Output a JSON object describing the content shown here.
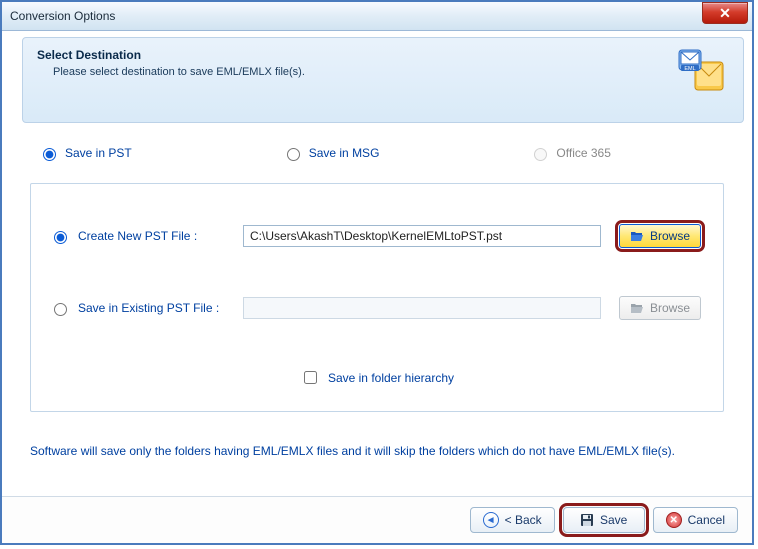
{
  "window": {
    "title": "Conversion Options"
  },
  "header": {
    "title": "Select Destination",
    "subtitle": "Please select destination to save EML/EMLX file(s)."
  },
  "formats": {
    "pst": {
      "label": "Save in PST",
      "selected": true
    },
    "msg": {
      "label": "Save in MSG",
      "selected": false
    },
    "o365": {
      "label": "Office 365",
      "selected": false,
      "disabled": true
    }
  },
  "options": {
    "create_new": {
      "label": "Create New PST File :",
      "selected": true,
      "path": "C:\\Users\\AkashT\\Desktop\\KernelEMLtoPST.pst",
      "browse_label": "Browse"
    },
    "save_existing": {
      "label": "Save in Existing PST File :",
      "selected": false,
      "path": "",
      "browse_label": "Browse"
    },
    "hierarchy": {
      "checked": false,
      "label": "Save in folder hierarchy"
    }
  },
  "info": "Software will save only the folders having EML/EMLX files and it will skip the folders which do not have EML/EMLX file(s).",
  "footer": {
    "back": "< Back",
    "save": "Save",
    "cancel": "Cancel"
  }
}
